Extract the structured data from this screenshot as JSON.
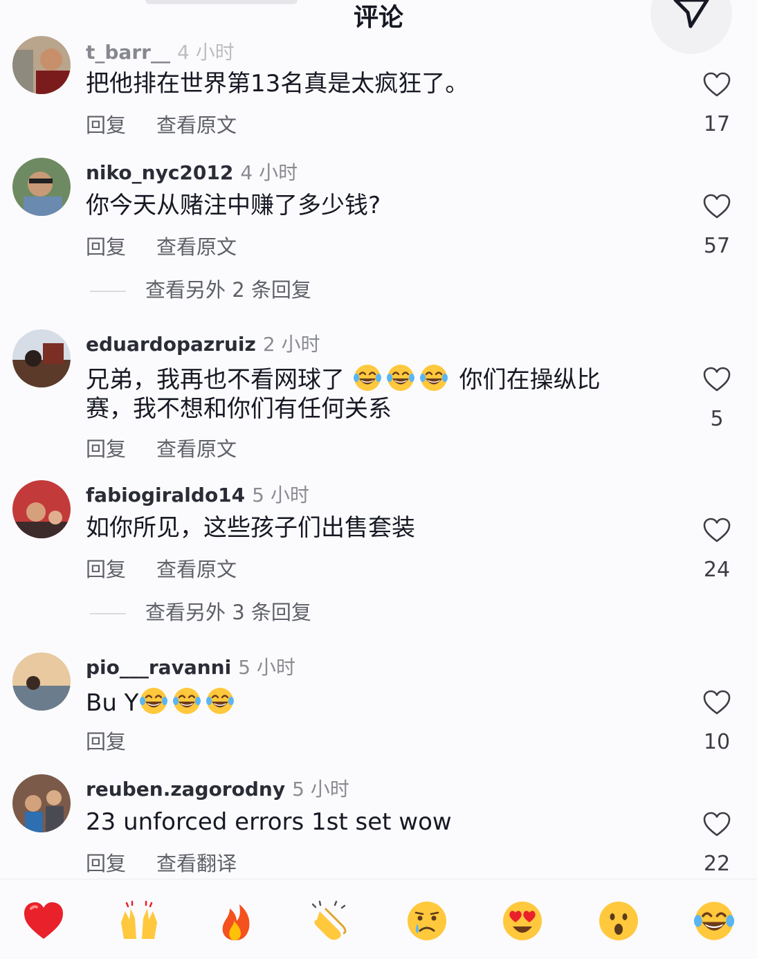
{
  "header": {
    "title": "评论"
  },
  "comments": [
    {
      "username": "t_barr__",
      "time": "4 小时",
      "text": "把他排在世界第13名真是太疯狂了。",
      "reply": "回复",
      "translate": "查看原文",
      "likes": "17"
    },
    {
      "username": "niko_nyc2012",
      "time": "4 小时",
      "text": "你今天从赌注中赚了多少钱?",
      "reply": "回复",
      "translate": "查看原文",
      "likes": "57",
      "more_replies": "查看另外 2 条回复"
    },
    {
      "username": "eduardopazruiz",
      "time": "2 小时",
      "text_before": "兄弟，我再也不看网球了",
      "text_after": "你们在操纵比赛，我不想和你们有任何关系",
      "reply": "回复",
      "translate": "查看原文",
      "likes": "5"
    },
    {
      "username": "fabiogiraldo14",
      "time": "5 小时",
      "text": "如你所见，这些孩子们出售套装",
      "reply": "回复",
      "translate": "查看原文",
      "likes": "24",
      "more_replies": "查看另外 3 条回复"
    },
    {
      "username": "pio___ravanni",
      "time": "5 小时",
      "text_before": "Bu Y",
      "reply": "回复",
      "likes": "10"
    },
    {
      "username": "reuben.zagorodny",
      "time": "5 小时",
      "text": "23 unforced errors 1st set wow",
      "reply": "回复",
      "translate": "查看翻译",
      "likes": "22"
    }
  ],
  "emoji_bar": [
    "heart",
    "raising-hands",
    "fire",
    "clapping-hands",
    "crying-face",
    "heart-eyes",
    "surprised-face",
    "tears-of-joy"
  ],
  "colors": {
    "text": "#161823",
    "secondary": "#8a8b91",
    "heart": "#e8212b",
    "emoji_yellow": "#ffc83d"
  }
}
